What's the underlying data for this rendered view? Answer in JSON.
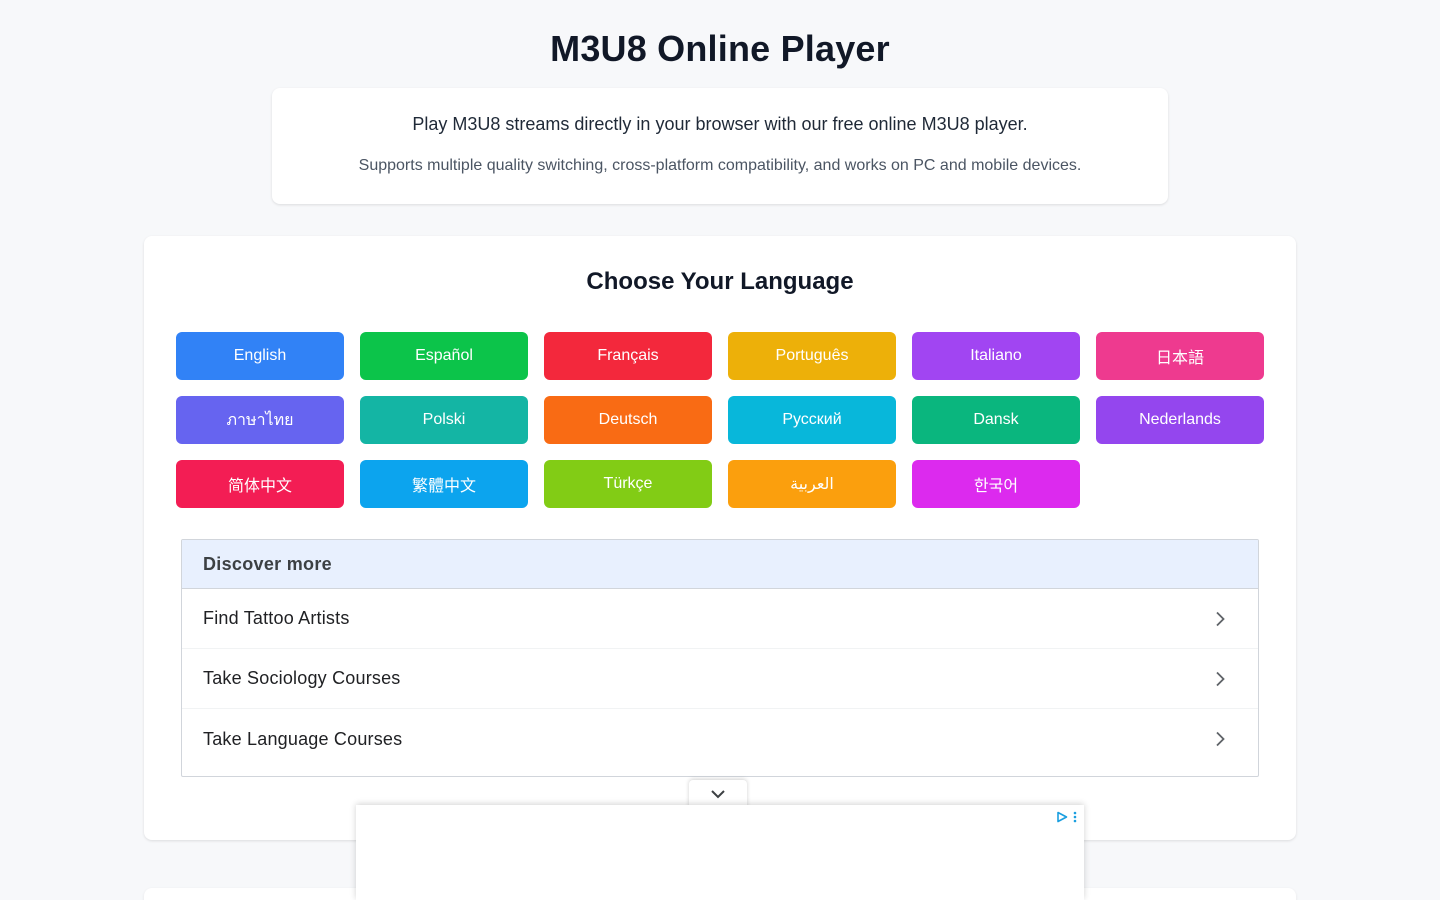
{
  "header": {
    "title": "M3U8 Online Player"
  },
  "intro": {
    "line1": "Play M3U8 streams directly in your browser with our free online M3U8 player.",
    "line2": "Supports multiple quality switching, cross-platform compatibility, and works on PC and mobile devices."
  },
  "languages": {
    "heading": "Choose Your Language",
    "items": [
      {
        "label": "English",
        "color": "#3182f6"
      },
      {
        "label": "Español",
        "color": "#0cc44a"
      },
      {
        "label": "Français",
        "color": "#f3283c"
      },
      {
        "label": "Português",
        "color": "#edb009"
      },
      {
        "label": "Italiano",
        "color": "#a145f2"
      },
      {
        "label": "日本語",
        "color": "#ee3a8f"
      },
      {
        "label": "ภาษาไทย",
        "color": "#6664f0"
      },
      {
        "label": "Polski",
        "color": "#14b5a4"
      },
      {
        "label": "Deutsch",
        "color": "#f96b14"
      },
      {
        "label": "Русский",
        "color": "#08b7da"
      },
      {
        "label": "Dansk",
        "color": "#0ab67e"
      },
      {
        "label": "Nederlands",
        "color": "#9446ee"
      },
      {
        "label": "简体中文",
        "color": "#f31d54"
      },
      {
        "label": "繁體中文",
        "color": "#0ca4ee"
      },
      {
        "label": "Türkçe",
        "color": "#82cc15"
      },
      {
        "label": "العربية",
        "color": "#fb9f0d"
      },
      {
        "label": "한국어",
        "color": "#dc2aee"
      }
    ]
  },
  "discover": {
    "header": "Discover more",
    "items": [
      {
        "label": "Find Tattoo Artists"
      },
      {
        "label": "Take Sociology Courses"
      },
      {
        "label": "Take Language Courses"
      }
    ]
  },
  "icons": {
    "chevron_right": "chevron-right-icon",
    "chevron_down": "chevron-down-icon",
    "ad_choices": "adchoices-icon",
    "ad_menu": "more-vertical-icon"
  }
}
